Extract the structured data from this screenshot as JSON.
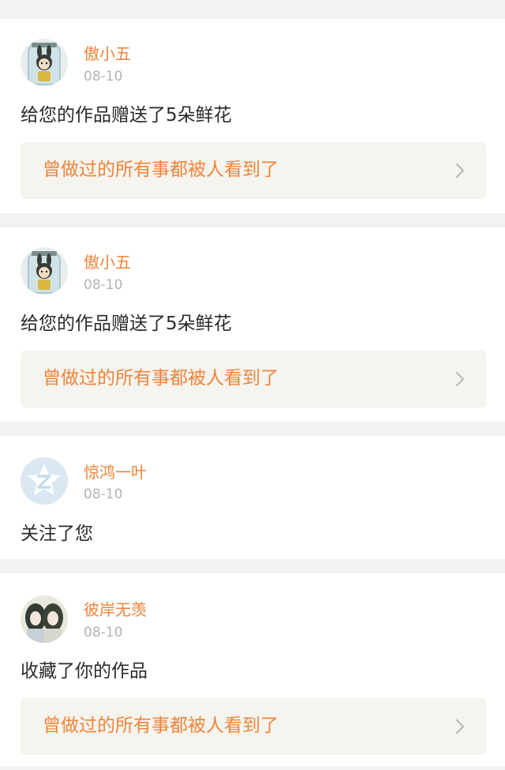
{
  "notifications": [
    {
      "username": "傲小五",
      "date": "08-10",
      "message": "给您的作品赠送了5朵鲜花",
      "work_title": "曾做过的所有事都被人看到了",
      "avatar_icon": "cartoon-character-jar-avatar"
    },
    {
      "username": "傲小五",
      "date": "08-10",
      "message": "给您的作品赠送了5朵鲜花",
      "work_title": "曾做过的所有事都被人看到了",
      "avatar_icon": "cartoon-character-jar-avatar"
    },
    {
      "username": "惊鸿一叶",
      "date": "08-10",
      "message": "关注了您",
      "avatar_icon": "default-z-avatar"
    },
    {
      "username": "彼岸无羡",
      "date": "08-10",
      "message": "收藏了你的作品",
      "work_title": "曾做过的所有事都被人看到了",
      "avatar_icon": "two-anime-characters-avatar"
    }
  ],
  "colors": {
    "accent": "#f0843a",
    "date_gray": "#b3b3b3",
    "link_box": "#f5f4ee",
    "separator": "#f2f2f2"
  }
}
